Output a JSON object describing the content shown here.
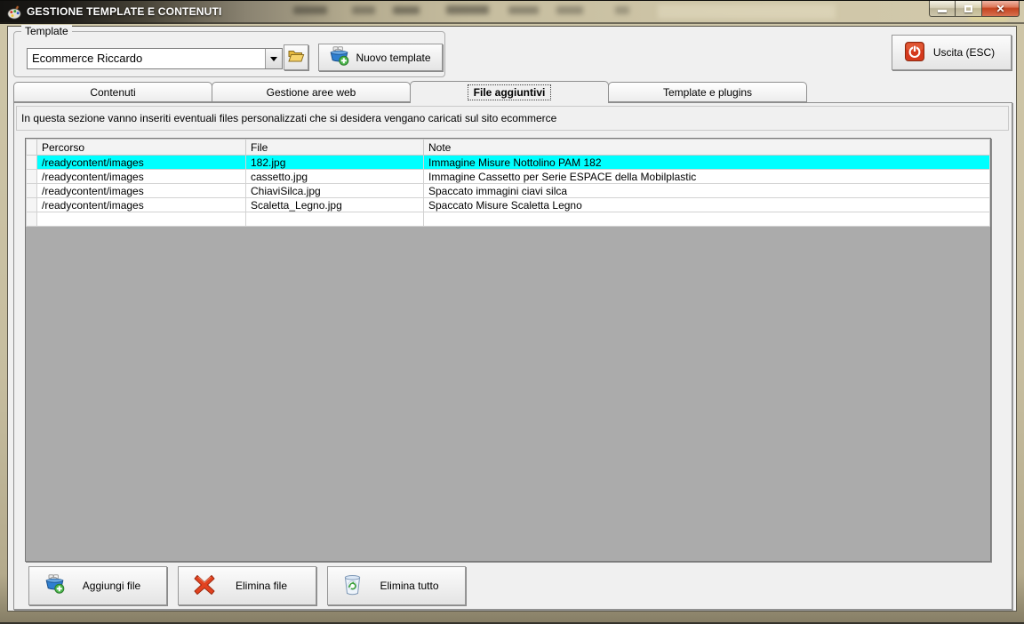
{
  "window": {
    "title": "GESTIONE TEMPLATE E CONTENUTI",
    "controls": {
      "minimize": "minimize",
      "maximize": "maximize",
      "close": "close"
    }
  },
  "template_section": {
    "group_label": "Template",
    "combo_value": "Ecommerce Riccardo",
    "new_template_button": "Nuovo template"
  },
  "exit_button_label": "Uscita (ESC)",
  "tabs": [
    {
      "label": "Contenuti",
      "active": false
    },
    {
      "label": "Gestione aree web",
      "active": false
    },
    {
      "label": "File aggiuntivi",
      "active": true
    },
    {
      "label": "Template e plugins",
      "active": false
    }
  ],
  "info_text": "In questa sezione vanno inseriti eventuali files personalizzati che si desidera vengano caricati sul sito ecommerce",
  "files_table": {
    "columns": [
      "Percorso",
      "File",
      "Note"
    ],
    "rows": [
      {
        "percorso": "/readycontent/images",
        "file": "182.jpg",
        "note": "Immagine Misure Nottolino PAM 182",
        "selected": true
      },
      {
        "percorso": "/readycontent/images",
        "file": "cassetto.jpg",
        "note": "Immagine Cassetto per Serie ESPACE della Mobilplastic",
        "selected": false
      },
      {
        "percorso": "/readycontent/images",
        "file": "ChiaviSilca.jpg",
        "note": "Spaccato immagini ciavi silca",
        "selected": false
      },
      {
        "percorso": "/readycontent/images",
        "file": "Scaletta_Legno.jpg",
        "note": "Spaccato Misure Scaletta Legno",
        "selected": false
      }
    ],
    "selected_row_color": "#00ffff"
  },
  "footer_buttons": {
    "add_file": "Aggiungi file",
    "delete_file": "Elimina file",
    "delete_all": "Elimina tutto"
  }
}
